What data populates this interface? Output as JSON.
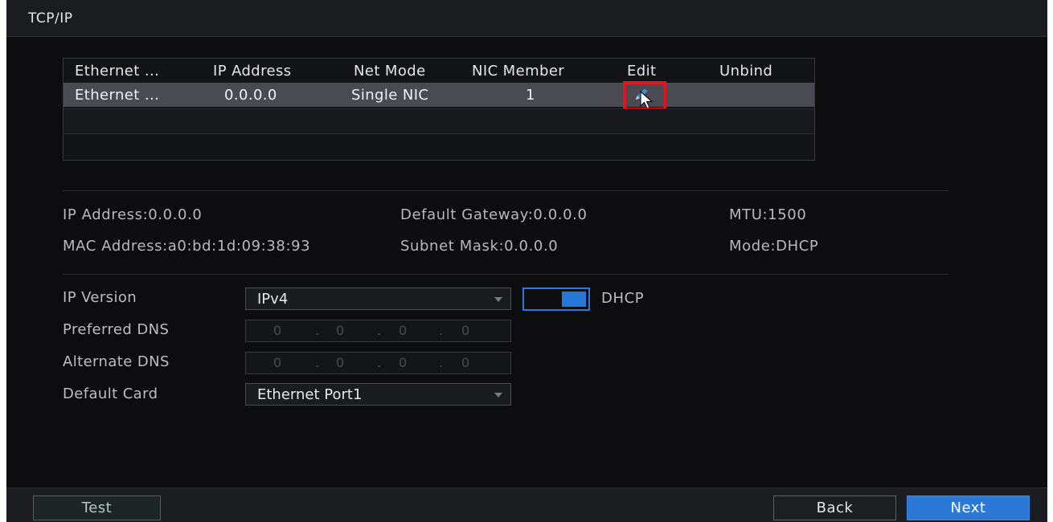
{
  "window": {
    "title": "TCP/IP"
  },
  "table": {
    "headers": [
      "Ethernet ...",
      "IP Address",
      "Net Mode",
      "NIC Member",
      "Edit",
      "Unbind"
    ],
    "rows": [
      {
        "ethernet": "Ethernet ...",
        "ip": "0.0.0.0",
        "net_mode": "Single NIC",
        "nic_member": "1",
        "edit_icon": "pencil-edit-icon"
      }
    ]
  },
  "info": {
    "ip_address_label": "IP Address:",
    "ip_address": "0.0.0.0",
    "gateway_label": "Default Gateway:",
    "gateway": "0.0.0.0",
    "mtu_label": "MTU:",
    "mtu": "1500",
    "mac_label": "MAC Address:",
    "mac": "a0:bd:1d:09:38:93",
    "subnet_label": "Subnet Mask:",
    "subnet": "0.0.0.0",
    "mode_label": "Mode:",
    "mode": "DHCP"
  },
  "form": {
    "ip_version_label": "IP Version",
    "ip_version_value": "IPv4",
    "dhcp_label": "DHCP",
    "dhcp_enabled": true,
    "preferred_dns_label": "Preferred DNS",
    "preferred_dns": [
      "0",
      "0",
      "0",
      "0"
    ],
    "alternate_dns_label": "Alternate DNS",
    "alternate_dns": [
      "0",
      "0",
      "0",
      "0"
    ],
    "default_card_label": "Default Card",
    "default_card_value": "Ethernet Port1"
  },
  "footer": {
    "test": "Test",
    "back": "Back",
    "next": "Next"
  },
  "colors": {
    "accent": "#2577d8",
    "highlight_box": "#e0141c",
    "row_selected": "#4a4b52"
  }
}
